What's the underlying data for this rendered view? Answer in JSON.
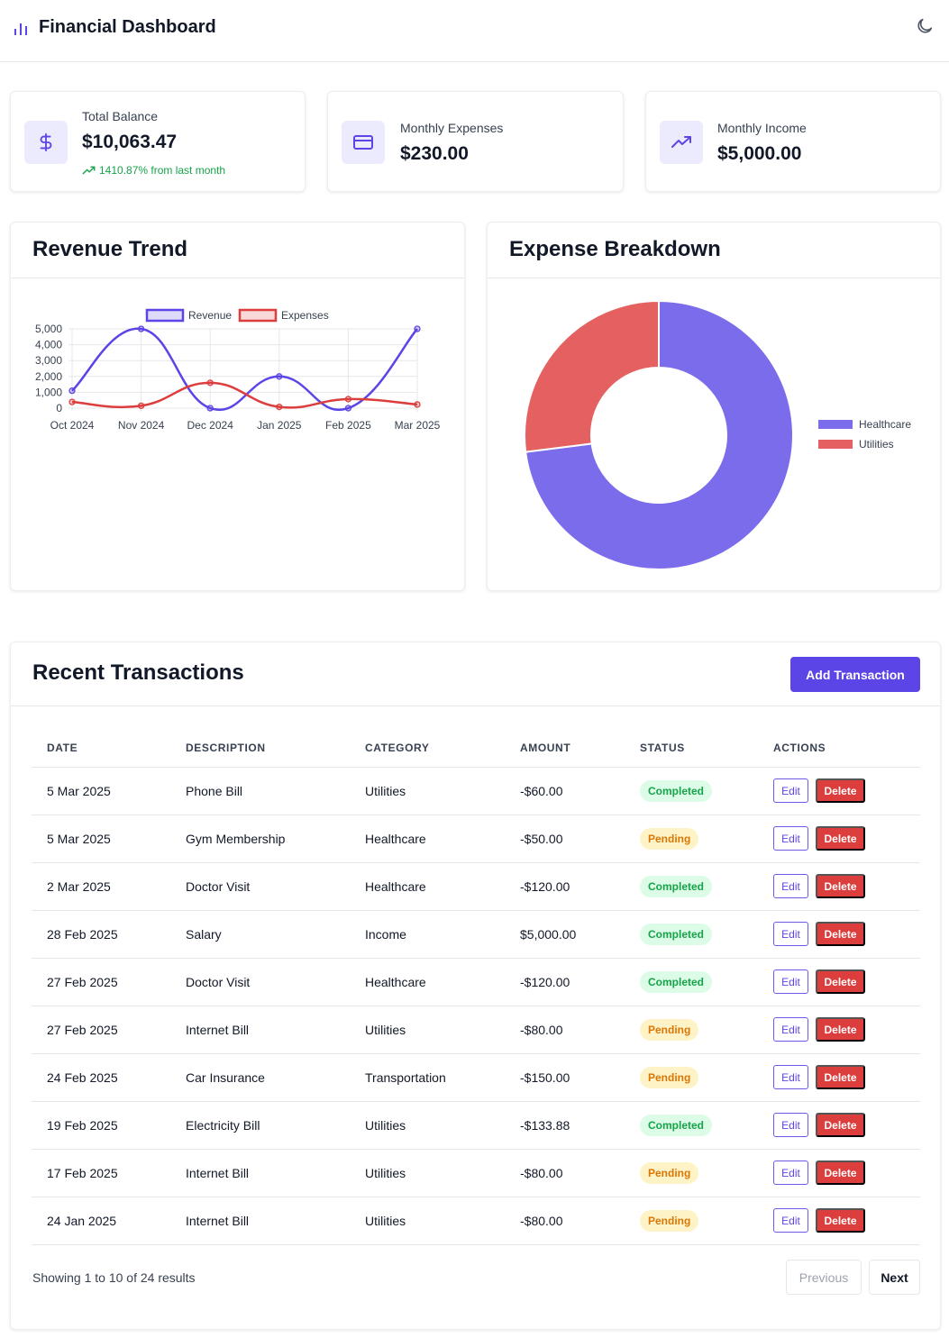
{
  "header": {
    "title": "Financial Dashboard",
    "logo_icon": "bar-chart-icon",
    "theme_toggle_icon": "moon-icon"
  },
  "stats": [
    {
      "label": "Total Balance",
      "value": "$10,063.47",
      "change": "1410.87% from last month",
      "icon": "dollar-icon"
    },
    {
      "label": "Monthly Expenses",
      "value": "$230.00",
      "icon": "credit-card-icon"
    },
    {
      "label": "Monthly Income",
      "value": "$5,000.00",
      "icon": "trending-up-icon"
    }
  ],
  "revenue_panel": {
    "title": "Revenue Trend"
  },
  "expense_panel": {
    "title": "Expense Breakdown"
  },
  "chart_data": [
    {
      "type": "line",
      "title": "Revenue Trend",
      "x": [
        "Oct 2024",
        "Nov 2024",
        "Dec 2024",
        "Jan 2025",
        "Feb 2025",
        "Mar 2025"
      ],
      "series": [
        {
          "name": "Revenue",
          "values": [
            1100,
            5000,
            0,
            2000,
            0,
            5000
          ],
          "color": "#5b45e6"
        },
        {
          "name": "Expenses",
          "values": [
            390,
            150,
            1600,
            80,
            570,
            230
          ],
          "color": "#dc3d3d"
        }
      ],
      "ylim": [
        0,
        5000
      ],
      "yticks": [
        "0",
        "1,000",
        "2,000",
        "3,000",
        "4,000",
        "5,000"
      ],
      "grid": true,
      "legend": "top"
    },
    {
      "type": "pie",
      "title": "Expense Breakdown",
      "categories": [
        "Healthcare",
        "Utilities"
      ],
      "values": [
        73,
        27
      ],
      "colors": [
        "#7b6cec",
        "#e56161"
      ],
      "legend": "right"
    }
  ],
  "transactions": {
    "title": "Recent Transactions",
    "add_label": "Add Transaction",
    "columns": [
      "DATE",
      "DESCRIPTION",
      "CATEGORY",
      "AMOUNT",
      "STATUS",
      "ACTIONS"
    ],
    "edit_label": "Edit",
    "delete_label": "Delete",
    "rows": [
      {
        "date": "5 Mar 2025",
        "description": "Phone Bill",
        "category": "Utilities",
        "amount": "-$60.00",
        "status": "Completed"
      },
      {
        "date": "5 Mar 2025",
        "description": "Gym Membership",
        "category": "Healthcare",
        "amount": "-$50.00",
        "status": "Pending"
      },
      {
        "date": "2 Mar 2025",
        "description": "Doctor Visit",
        "category": "Healthcare",
        "amount": "-$120.00",
        "status": "Completed"
      },
      {
        "date": "28 Feb 2025",
        "description": "Salary",
        "category": "Income",
        "amount": "$5,000.00",
        "status": "Completed"
      },
      {
        "date": "27 Feb 2025",
        "description": "Doctor Visit",
        "category": "Healthcare",
        "amount": "-$120.00",
        "status": "Completed"
      },
      {
        "date": "27 Feb 2025",
        "description": "Internet Bill",
        "category": "Utilities",
        "amount": "-$80.00",
        "status": "Pending"
      },
      {
        "date": "24 Feb 2025",
        "description": "Car Insurance",
        "category": "Transportation",
        "amount": "-$150.00",
        "status": "Pending"
      },
      {
        "date": "19 Feb 2025",
        "description": "Electricity Bill",
        "category": "Utilities",
        "amount": "-$133.88",
        "status": "Completed"
      },
      {
        "date": "17 Feb 2025",
        "description": "Internet Bill",
        "category": "Utilities",
        "amount": "-$80.00",
        "status": "Pending"
      },
      {
        "date": "24 Jan 2025",
        "description": "Internet Bill",
        "category": "Utilities",
        "amount": "-$80.00",
        "status": "Pending"
      }
    ],
    "footer": "Showing 1 to 10 of 24 results",
    "prev_label": "Previous",
    "next_label": "Next"
  }
}
